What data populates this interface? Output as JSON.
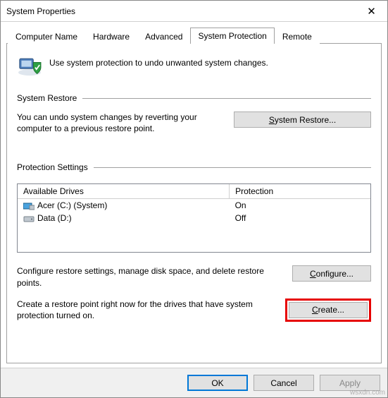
{
  "window": {
    "title": "System Properties",
    "close_glyph": "✕"
  },
  "tabs": {
    "computer_name": "Computer Name",
    "hardware": "Hardware",
    "advanced": "Advanced",
    "system_protection": "System Protection",
    "remote": "Remote"
  },
  "intro": "Use system protection to undo unwanted system changes.",
  "restore": {
    "header": "System Restore",
    "desc": "You can undo system changes by reverting your computer to a previous restore point.",
    "btn_prefix": "S",
    "btn_rest": "ystem Restore..."
  },
  "protection": {
    "header": "Protection Settings",
    "col_drives": "Available Drives",
    "col_protection": "Protection",
    "drives": [
      {
        "name": "Acer (C:) (System)",
        "status": "On",
        "kind": "sys"
      },
      {
        "name": "Data (D:)",
        "status": "Off",
        "kind": "hdd"
      }
    ],
    "configure_desc": "Configure restore settings, manage disk space, and delete restore points.",
    "configure_prefix": "C",
    "configure_rest": "onfigure...",
    "create_desc": "Create a restore point right now for the drives that have system protection turned on.",
    "create_prefix": "C",
    "create_rest": "reate..."
  },
  "footer": {
    "ok": "OK",
    "cancel": "Cancel",
    "apply": "Apply"
  },
  "watermark": "wsxdn.com"
}
